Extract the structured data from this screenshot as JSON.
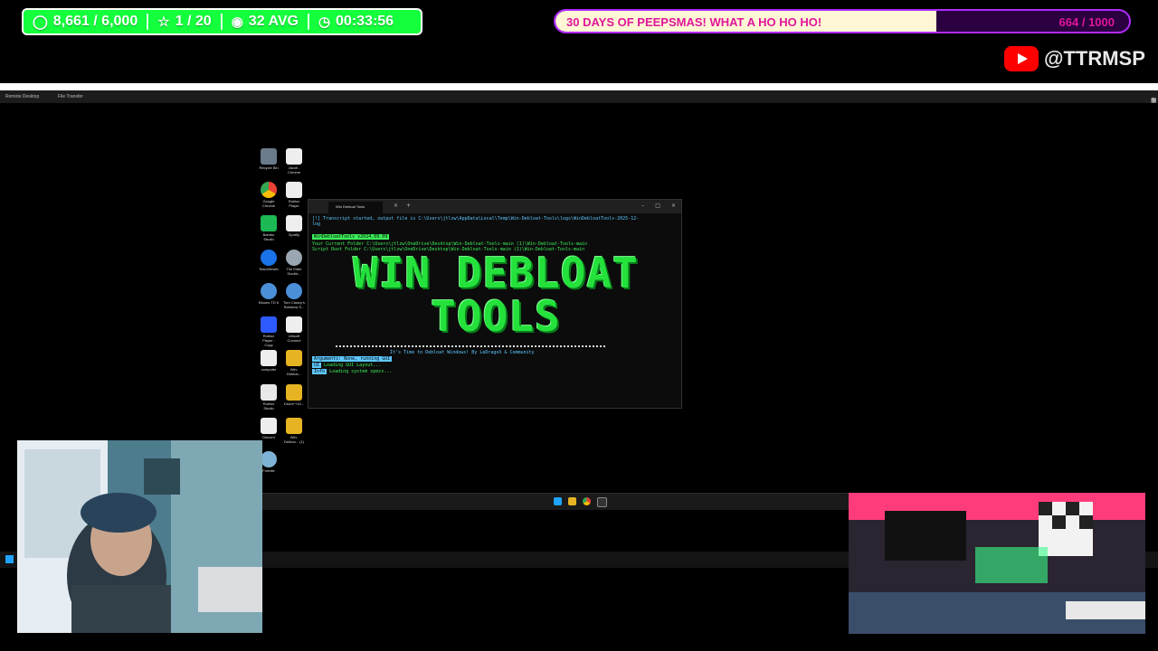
{
  "stats": {
    "points": "8,661 / 6,000",
    "stars": "1 / 20",
    "views": "32 AVG",
    "time": "00:33:56"
  },
  "goal": {
    "title": "30 DAYS OF PEEPSMAS! WHAT A HO HO HO!",
    "current": 664,
    "target": 1000,
    "count_label": "664 / 1000",
    "progress": 0.664
  },
  "youtube": {
    "handle": "@TTRMSP"
  },
  "remote": {
    "tabs": [
      "Remote Desktop",
      "File Transfer"
    ]
  },
  "desktop_icons": [
    {
      "label": "Recycle Bin"
    },
    {
      "label": "Jacob - Chrome"
    },
    {
      "label": "Google Chrome"
    },
    {
      "label": "Roblox Player"
    },
    {
      "label": "Bambu Studio"
    },
    {
      "label": "Spotify"
    },
    {
      "label": "TeamViewer"
    },
    {
      "label": "The Elder Scrolls..."
    },
    {
      "label": "Bloons TD 6"
    },
    {
      "label": "Tom Clancy's Rainbow S..."
    },
    {
      "label": "Roblox Player - Copy"
    },
    {
      "label": "Ubisoft Connect"
    },
    {
      "label": "computer"
    },
    {
      "label": "Win-Debloa..."
    },
    {
      "label": "Roblox Studio"
    },
    {
      "label": "Drum++10..."
    },
    {
      "label": "Discord"
    },
    {
      "label": "Win-Debloa... (1)"
    },
    {
      "label": "Fortnite"
    }
  ],
  "terminal": {
    "tab_title": "Win Debloat Tools",
    "line1_tag": "[!]",
    "line1": "Transcript started, output file is C:\\Users\\jtlzw\\AppData\\Local\\Temp\\Win-Debloat-Tools\\logs\\WinDebloatTools-2025-12-",
    "line1b": "log",
    "version": "WinDebloatTools v2024.09.09",
    "current_folder": "Your Current Folder C:\\Users\\jtlzw\\OneDrive\\Desktop\\Win-Debloat-Tools-main (1)\\Win-Debloat-Tools-main",
    "root_folder": "Script Root Folder C:\\Users\\jtlzw\\OneDrive\\Desktop\\Win-Debloat-Tools-main (1)\\Win-Debloat-Tools-main",
    "banner_line1": "WIN DEBLOAT",
    "banner_line2": "TOOLS",
    "tagline": "It's Time to Debloat Windows! By LeDragoX & Community",
    "args": "Arguments: None, running GUI",
    "ui_tag": "UI",
    "ui_line": "Loading GUI Layout...",
    "info_tag": "Info",
    "info_line": "Loading system specs..."
  },
  "colors": {
    "stats_bg": "#14ff3c",
    "goal_border": "#b02bff",
    "goal_text": "#e0159a",
    "terminal_green": "#24e13c",
    "terminal_cyan": "#5ec8ff"
  }
}
